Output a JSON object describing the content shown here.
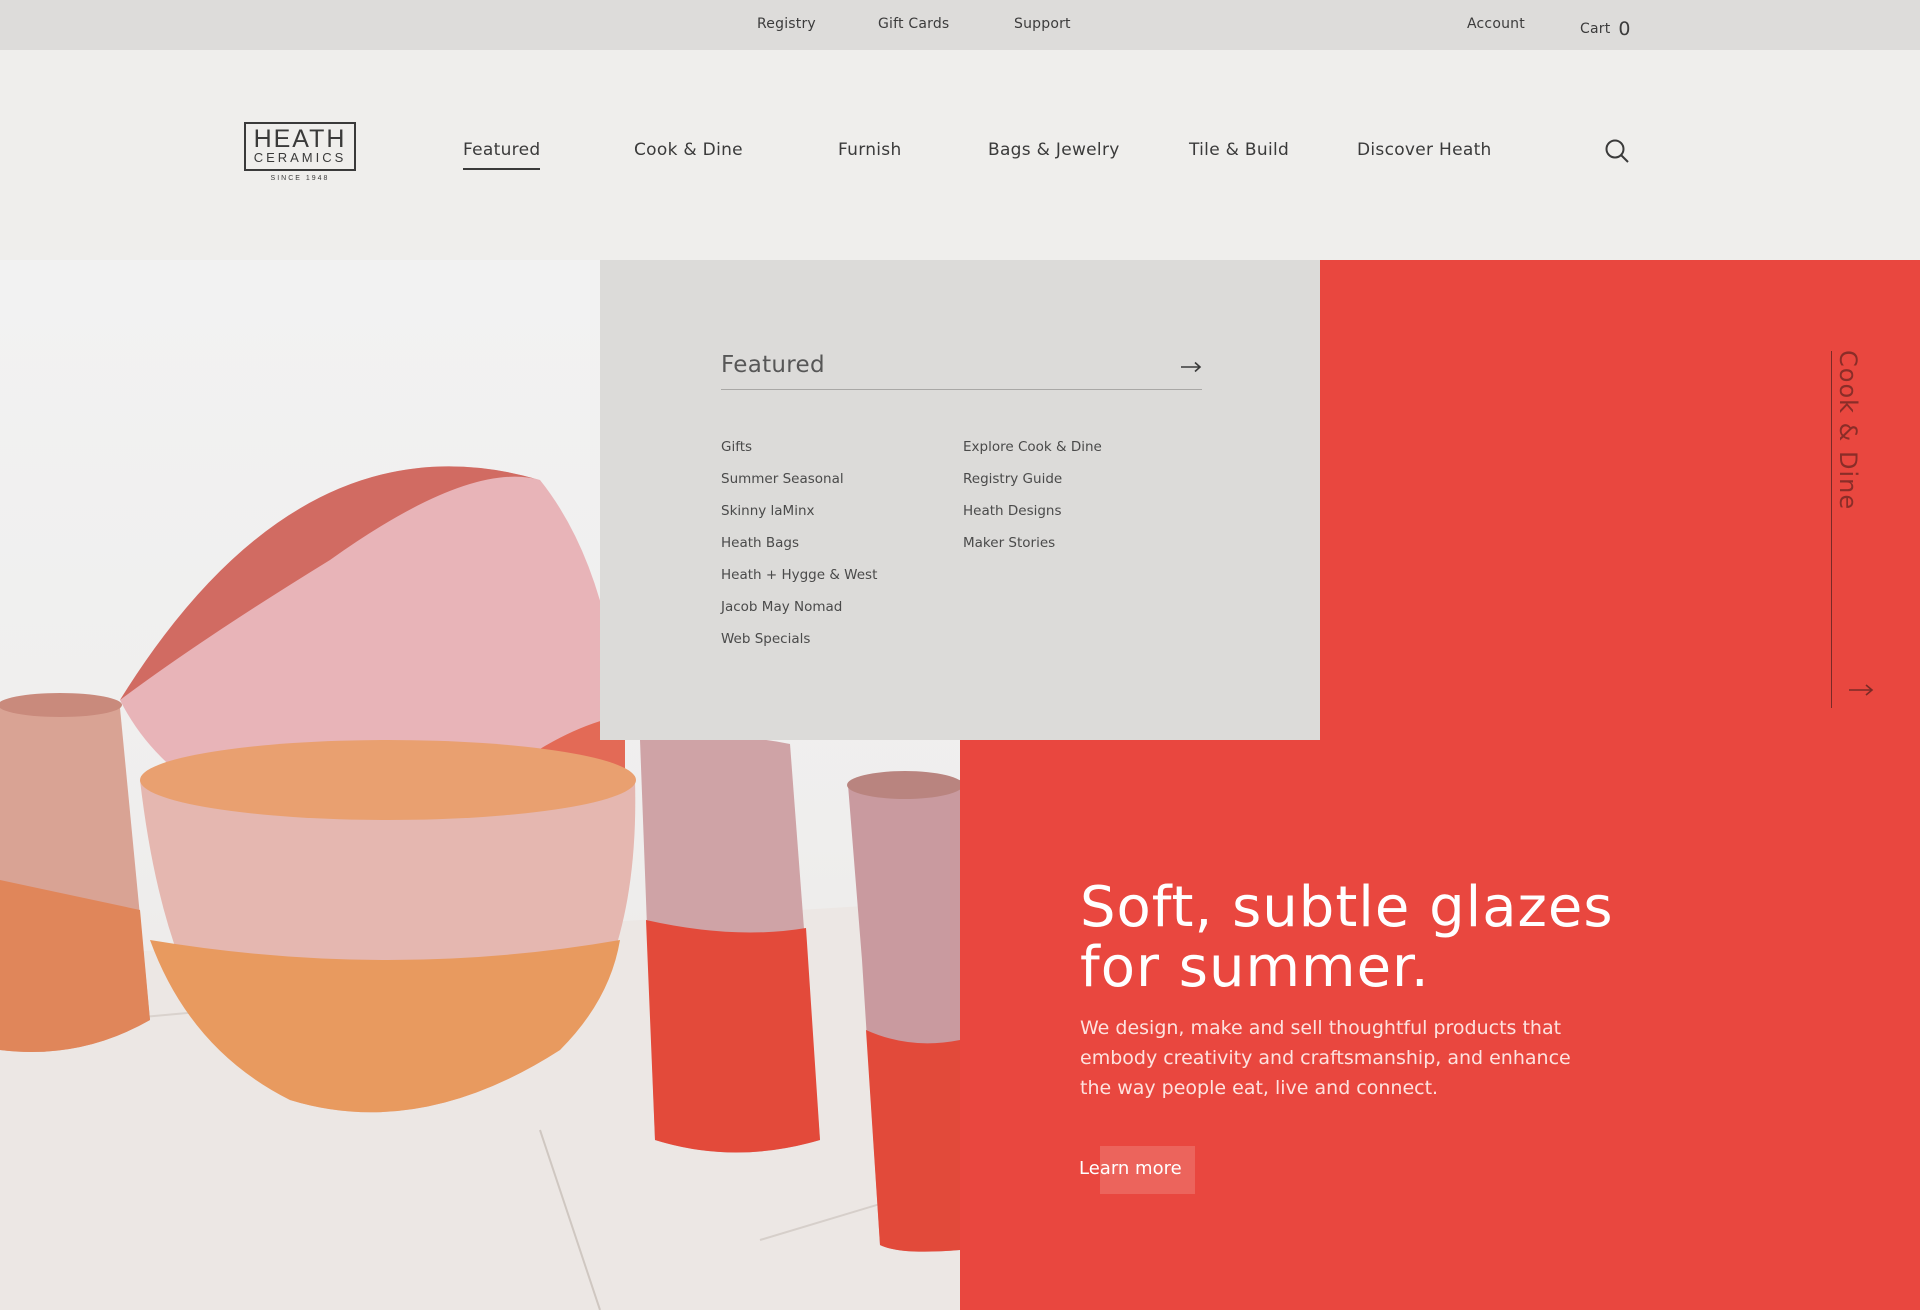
{
  "utility": {
    "links": [
      "Registry",
      "Gift Cards",
      "Support"
    ],
    "account": "Account",
    "cart_label": "Cart",
    "cart_count": "0"
  },
  "logo": {
    "top": "HEATH",
    "bottom": "CERAMICS",
    "since": "SINCE 1948"
  },
  "nav": {
    "items": [
      "Featured",
      "Cook & Dine",
      "Furnish",
      "Bags & Jewelry",
      "Tile & Build",
      "Discover Heath"
    ],
    "active_index": 0,
    "search_icon": "search-icon"
  },
  "dropdown": {
    "title": "Featured",
    "arrow_icon": "arrow-right-icon",
    "col1": [
      "Gifts",
      "Summer Seasonal",
      "Skinny laMinx",
      "Heath Bags",
      "Heath + Hygge & West",
      "Jacob May Nomad",
      "Web Specials"
    ],
    "col2": [
      "Explore Cook & Dine",
      "Registry Guide",
      "Heath Designs",
      "Maker Stories"
    ]
  },
  "hero": {
    "side_label": "Cook & Dine",
    "side_arrow_icon": "arrow-right-icon",
    "headline_line1": "Soft, subtle glazes",
    "headline_line2": "for summer.",
    "body": "We design, make and sell thoughtful products that embody creativity and craftsmanship, and enhance the way people eat, live and connect.",
    "cta": "Learn more",
    "image": "ceramic-cups-photo"
  },
  "colors": {
    "accent_red": "#e9473f",
    "header_bg": "#efeeec",
    "utility_bg": "#dddcda",
    "dropdown_bg": "#dcdbd9",
    "text": "#3a3a3a"
  }
}
